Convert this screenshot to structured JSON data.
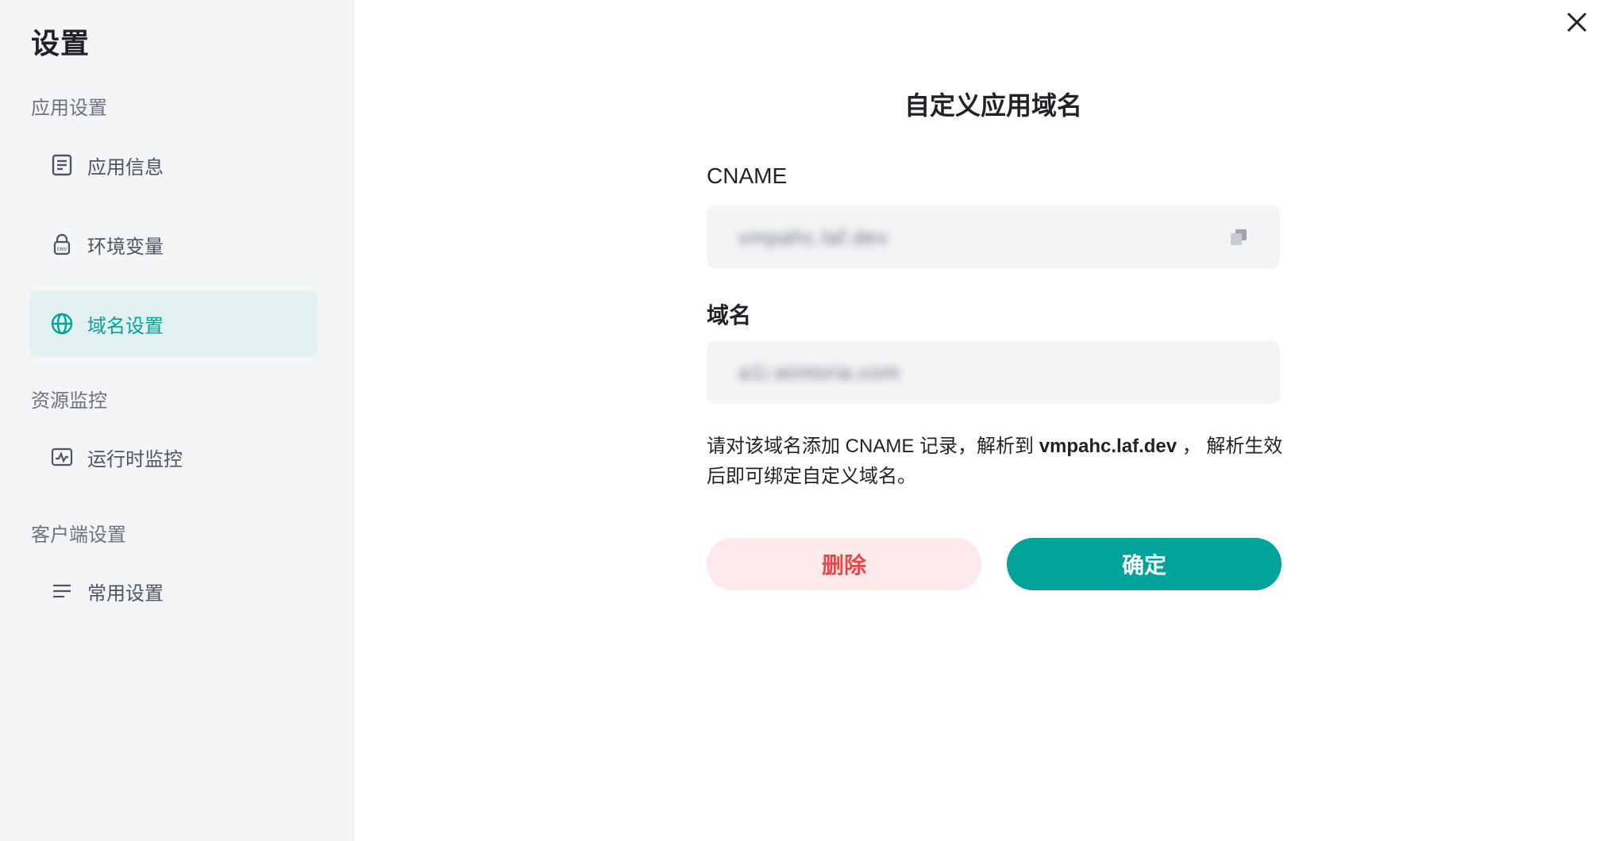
{
  "sidebar": {
    "title": "设置",
    "sections": [
      {
        "label": "应用设置"
      },
      {
        "label": "资源监控"
      },
      {
        "label": "客户端设置"
      }
    ],
    "items": [
      {
        "label": "应用信息",
        "icon": "document-icon"
      },
      {
        "label": "环境变量",
        "icon": "lock-env-icon"
      },
      {
        "label": "域名设置",
        "icon": "globe-icon",
        "active": true
      },
      {
        "label": "运行时监控",
        "icon": "monitor-icon"
      },
      {
        "label": "常用设置",
        "icon": "menu-lines-icon"
      }
    ]
  },
  "close": {
    "icon": "close-icon"
  },
  "dialog": {
    "title": "自定义应用域名",
    "cname_label": "CNAME",
    "cname_value": "vmpahc.laf.dev",
    "domain_label": "域名",
    "domain_value": "a1i.wintoria.com",
    "hint_prefix": "请对该域名添加 CNAME 记录，解析到 ",
    "hint_target": "vmpahc.laf.dev",
    "hint_suffix": " ， 解析生效后即可绑定自定义域名。",
    "delete_label": "删除",
    "confirm_label": "确定"
  },
  "colors": {
    "accent": "#00a39a",
    "active_bg": "#e3f0f2",
    "danger_text": "#e5484d",
    "danger_bg": "#fde8ea"
  }
}
